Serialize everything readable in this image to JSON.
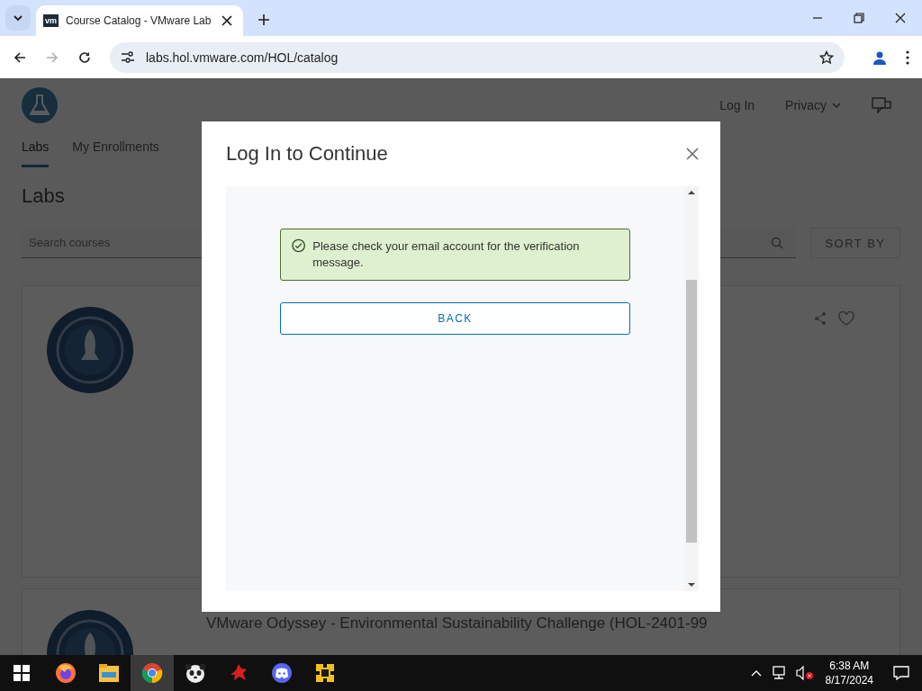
{
  "browser": {
    "tab": {
      "favicon": "vm",
      "title": "Course Catalog - VMware Lab"
    },
    "address": "labs.hol.vmware.com/HOL/catalog"
  },
  "page": {
    "header_links": [
      {
        "label": "Log In",
        "kind": "link"
      },
      {
        "label": "Privacy",
        "kind": "menu"
      }
    ],
    "tabs": [
      {
        "label": "Labs",
        "selected": true
      },
      {
        "label": "My Enrollments",
        "selected": false
      }
    ],
    "heading": "Labs",
    "search": {
      "placeholder": "Search courses"
    },
    "sort_button": "SORT BY",
    "cards": [
      {
        "kind": "rocket-badge"
      },
      {
        "kind": "rocket-badge",
        "title": "VMware Odyssey - Environmental Sustainability Challenge (HOL-2401-99"
      }
    ]
  },
  "modal": {
    "title": "Log In to Continue",
    "alert": {
      "kind": "success",
      "message": "Please check your email account for the verification message."
    },
    "button": "BACK"
  },
  "taskbar": {
    "apps": [
      {
        "kind": "firefox",
        "selected": false
      },
      {
        "kind": "files",
        "selected": false
      },
      {
        "kind": "chrome",
        "selected": true
      },
      {
        "kind": "panda",
        "selected": false
      },
      {
        "kind": "bird",
        "selected": false
      },
      {
        "kind": "discord",
        "selected": false
      },
      {
        "kind": "puzzle",
        "selected": false
      }
    ],
    "time": "6:38 AM",
    "date": "8/17/2024"
  }
}
